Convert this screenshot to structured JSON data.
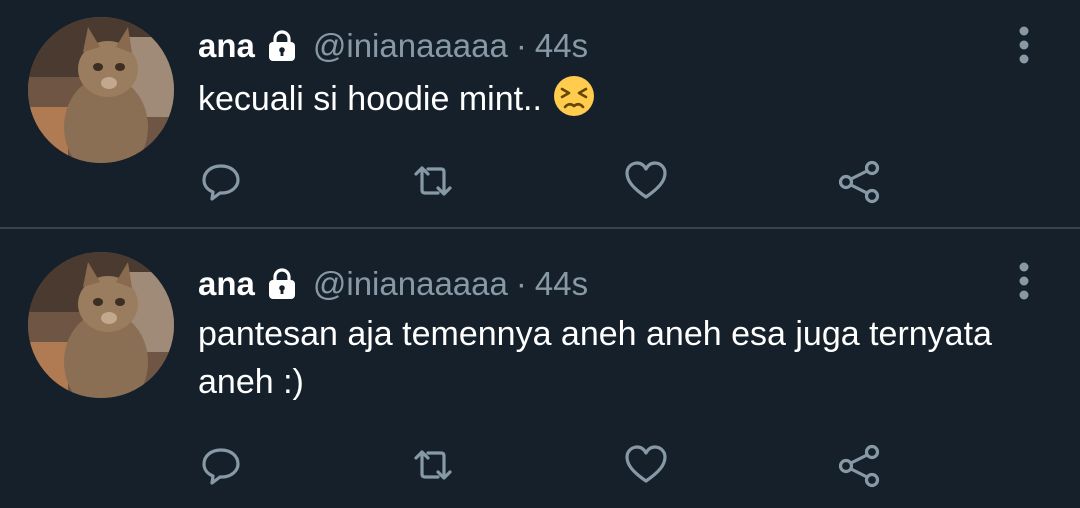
{
  "colors": {
    "background": "#15202b",
    "text_primary": "#ffffff",
    "text_secondary": "#8899a6",
    "divider": "#38444d"
  },
  "tweets": [
    {
      "display_name": "ana",
      "handle": "@inianaaaaa",
      "separator": "·",
      "time": "44s",
      "text": "kecuali si hoodie mint..",
      "emoji": "persevering-face",
      "protected_icon": "lock-icon",
      "actions": [
        "reply-icon",
        "retweet-icon",
        "like-icon",
        "share-icon"
      ]
    },
    {
      "display_name": "ana",
      "handle": "@inianaaaaa",
      "separator": "·",
      "time": "44s",
      "text": "pantesan aja temennya aneh aneh esa juga ternyata aneh :)",
      "protected_icon": "lock-icon",
      "actions": [
        "reply-icon",
        "retweet-icon",
        "like-icon",
        "share-icon"
      ]
    }
  ]
}
